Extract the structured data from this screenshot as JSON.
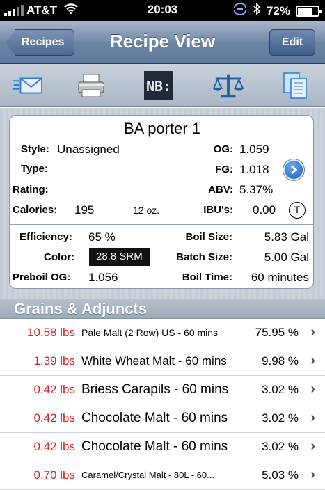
{
  "status_bar": {
    "carrier": "AT&T",
    "time": "20:03",
    "battery": "72%",
    "battery_level": 0.72
  },
  "nav": {
    "back_label": "Recipes",
    "title": "Recipe View",
    "edit_label": "Edit"
  },
  "toolbar": {
    "icons": [
      "mail-icon",
      "printer-icon",
      "nb-logo-icon",
      "scale-icon",
      "copy-icon"
    ],
    "nb_text": "NB:"
  },
  "recipe": {
    "name": "BA porter 1",
    "style_label": "Style:",
    "style_value": "Unassigned",
    "type_label": "Type:",
    "rating_label": "Rating:",
    "calories_label": "Calories:",
    "calories_value": "195",
    "serving": "12 oz.",
    "og_label": "OG:",
    "og_value": "1.059",
    "fg_label": "FG:",
    "fg_value": "1.018",
    "abv_label": "ABV:",
    "abv_value": "5.37%",
    "ibu_label": "IBU's:",
    "ibu_value": "0.00",
    "ibu_button": "T",
    "efficiency_label": "Efficiency:",
    "efficiency_value": "65 %",
    "color_label": "Color:",
    "color_value": "28.8 SRM",
    "preboil_label": "Preboil OG:",
    "preboil_value": "1.056",
    "boil_size_label": "Boil Size:",
    "boil_size_value": "5.83 Gal",
    "batch_size_label": "Batch Size:",
    "batch_size_value": "5.00 Gal",
    "boil_time_label": "Boil Time:",
    "boil_time_value": "60 minutes"
  },
  "section": {
    "title": "Grains & Adjuncts"
  },
  "grains": [
    {
      "amount": "10.58 lbs",
      "name": "Pale Malt (2 Row) US - 60 mins",
      "percent": "75.95 %"
    },
    {
      "amount": "1.39 lbs",
      "name": "White Wheat Malt - 60 mins",
      "percent": "9.98 %"
    },
    {
      "amount": "0.42 lbs",
      "name": "Briess Carapils - 60 mins",
      "percent": "3.02 %"
    },
    {
      "amount": "0.42 lbs",
      "name": "Chocolate Malt - 60 mins",
      "percent": "3.02 %"
    },
    {
      "amount": "0.42 lbs",
      "name": "Chocolate Malt - 60 mins",
      "percent": "3.02 %"
    },
    {
      "amount": "0.70 lbs",
      "name": "Caramel/Crystal Malt - 80L - 60...",
      "percent": "5.03 %"
    }
  ],
  "colors": {
    "amount_red": "#e21b1b",
    "nav_blue": "#6a84a4",
    "detail_blue": "#1b5fc4"
  }
}
